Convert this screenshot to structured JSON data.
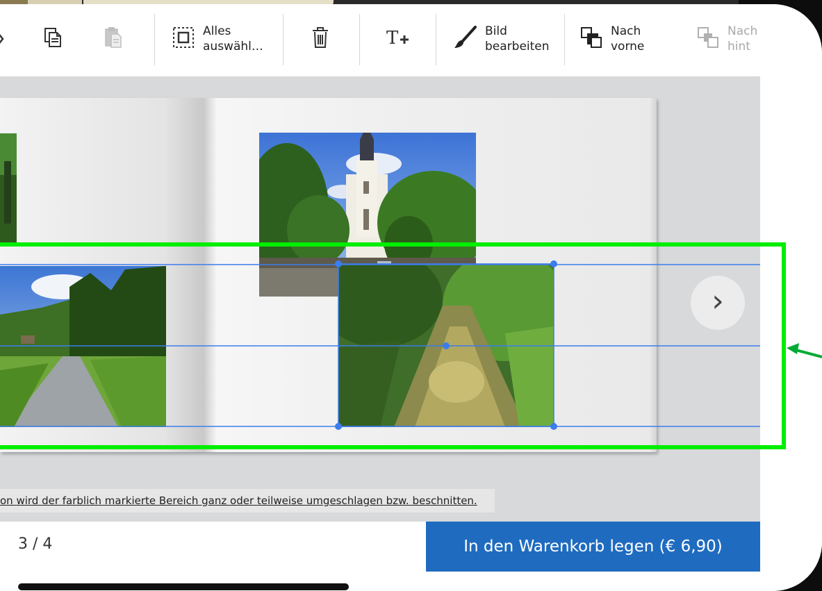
{
  "toolbar": {
    "items": [
      {
        "label": "",
        "icon": "copy-icon"
      },
      {
        "label": "",
        "icon": "paste-icon"
      },
      {
        "label": "Alles\nauswähl…",
        "icon": "select-all-icon"
      },
      {
        "label": "",
        "icon": "trash-icon"
      },
      {
        "label": "",
        "icon": "add-text-icon"
      },
      {
        "label": "Bild\nbearbeiten",
        "icon": "brush-icon"
      },
      {
        "label": "Nach\nvorne",
        "icon": "bring-forward-icon"
      },
      {
        "label": "Nach\nhint",
        "icon": "send-backward-icon"
      }
    ]
  },
  "canvas": {
    "next_icon": "›"
  },
  "notice": "on wird der farblich markierte Bereich ganz oder teilweise umgeschlagen bzw. beschnitten.",
  "pagination": {
    "label": "3 / 4"
  },
  "cart": {
    "label": "In den Warenkorb legen (€ 6,90)"
  },
  "colors": {
    "accent": "#1f6bbf",
    "selection": "#3b7ded",
    "highlight": "#00ee00"
  }
}
